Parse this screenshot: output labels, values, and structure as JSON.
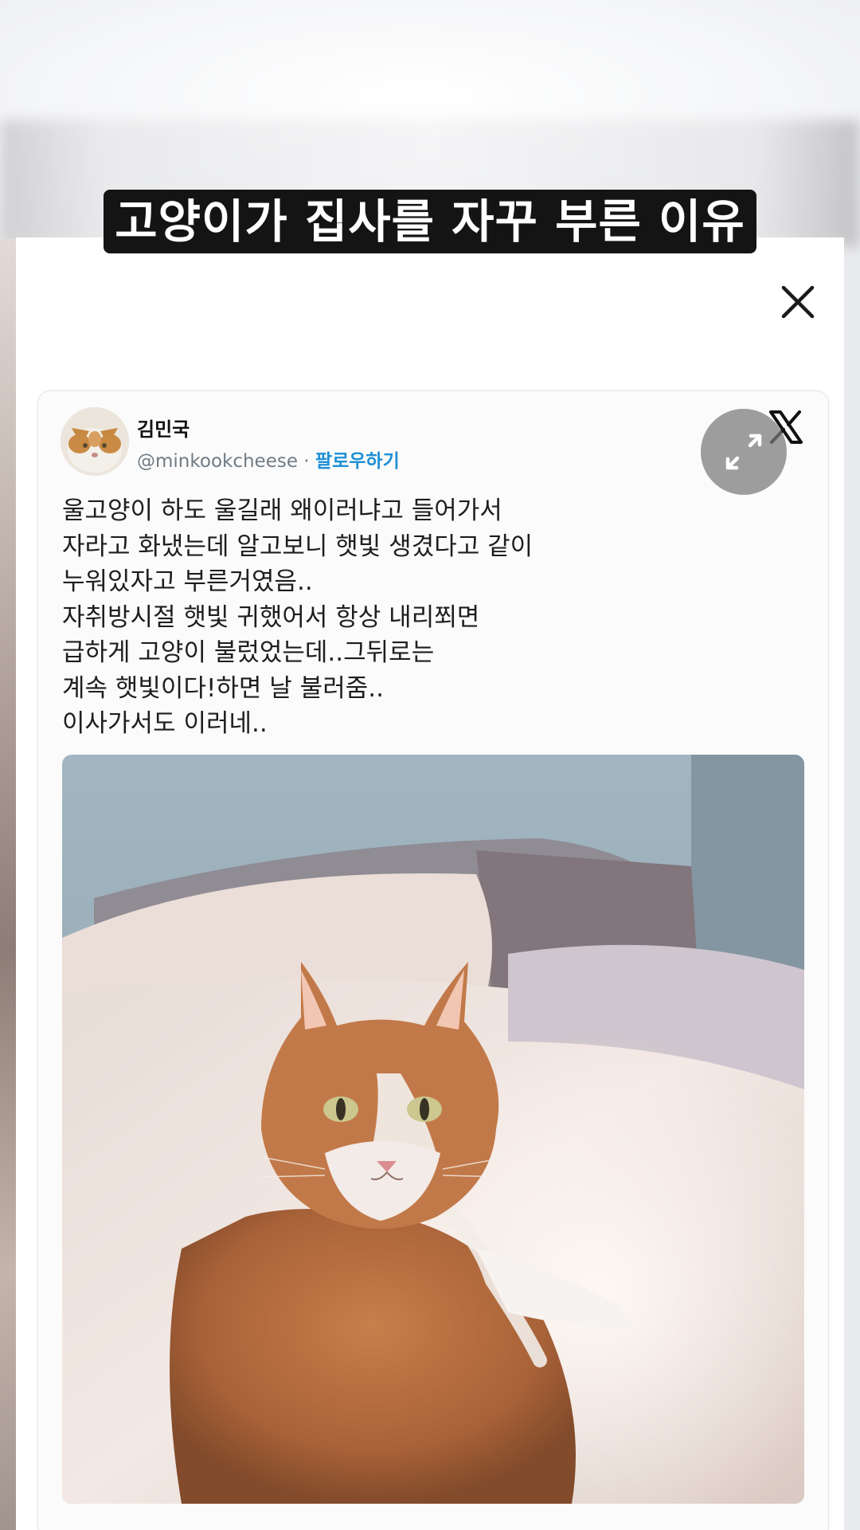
{
  "caption": {
    "text": "고양이가 집사를 자꾸 부른 이유"
  },
  "overlay": {
    "close_icon": "close-icon"
  },
  "tweet": {
    "author_name": "김민국",
    "handle": "@minkookcheese",
    "separator": " · ",
    "follow_label": "팔로우하기",
    "platform_icon": "x-logo-icon",
    "expand_icon": "expand-icon",
    "text": "울고양이 하도 울길래 왜이러냐고 들어가서\n자라고 화냈는데 알고보니 햇빛 생겼다고 같이\n누워있자고 부른거였음..\n자취방시절 햇빛 귀했어서 항상 내리쬐면\n급하게 고양이 불렀었는데..그뒤로는\n계속 햇빛이다!하면 날 불러줌..\n이사가서도 이러네..",
    "colors": {
      "follow": "#1d8fd6",
      "handle": "#707b85",
      "text": "#1e1e1e"
    }
  },
  "caption_colors": {
    "background": "#141414",
    "text": "#ffffff"
  }
}
